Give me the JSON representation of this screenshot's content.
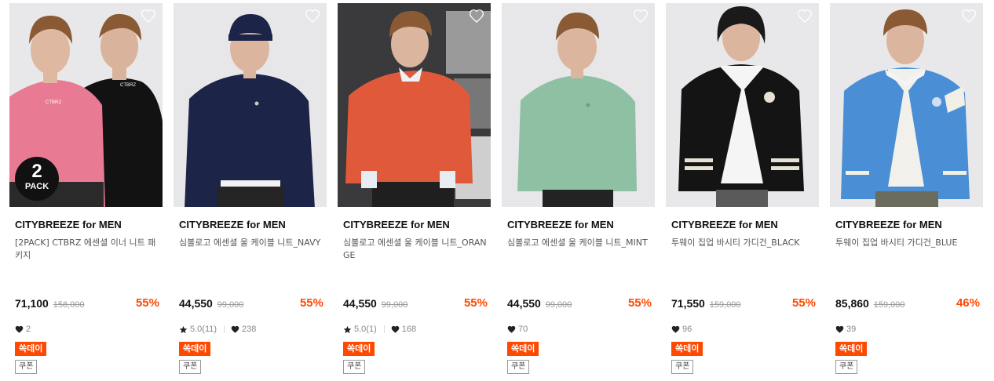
{
  "products": [
    {
      "brand": "CITYBREEZE for MEN",
      "name": "[2PACK] CTBRZ 에센셜 이너 니트 패키지",
      "price": "71,100",
      "original_price": "158,000",
      "discount": "55%",
      "rating": "",
      "rating_count": "",
      "likes": "2",
      "sale_tag": "쏙데이",
      "coupon_tag": "쿠폰",
      "pack_badge_number": "2",
      "pack_badge_text": "PACK",
      "image_bg": "#e8e8ea",
      "garment_color": "#e97a93",
      "garment_color_2": "#121212"
    },
    {
      "brand": "CITYBREEZE for MEN",
      "name": "심볼로고 에센셜 울 케이블 니트_NAVY",
      "price": "44,550",
      "original_price": "99,000",
      "discount": "55%",
      "rating": "5.0(11)",
      "rating_count": "",
      "likes": "238",
      "sale_tag": "쏙데이",
      "coupon_tag": "쿠폰",
      "image_bg": "#e7e7e9",
      "garment_color": "#1c2447"
    },
    {
      "brand": "CITYBREEZE for MEN",
      "name": "심볼로고 에센셜 울 케이블 니트_ORANGE",
      "price": "44,550",
      "original_price": "99,000",
      "discount": "55%",
      "rating": "5.0(1)",
      "rating_count": "",
      "likes": "168",
      "sale_tag": "쏙데이",
      "coupon_tag": "쿠폰",
      "image_bg": "#3a3a3c",
      "garment_color": "#e0593a"
    },
    {
      "brand": "CITYBREEZE for MEN",
      "name": "심볼로고 에센셜 울 케이블 니트_MINT",
      "price": "44,550",
      "original_price": "99,000",
      "discount": "55%",
      "rating": "",
      "rating_count": "",
      "likes": "70",
      "sale_tag": "쏙데이",
      "coupon_tag": "쿠폰",
      "image_bg": "#e7e7e9",
      "garment_color": "#8ec0a4"
    },
    {
      "brand": "CITYBREEZE for MEN",
      "name": "투웨이 집업 바시티 가디건_BLACK",
      "price": "71,550",
      "original_price": "159,000",
      "discount": "55%",
      "rating": "",
      "rating_count": "",
      "likes": "96",
      "sale_tag": "쏙데이",
      "coupon_tag": "쿠폰",
      "image_bg": "#e8e8ea",
      "garment_color": "#141414"
    },
    {
      "brand": "CITYBREEZE for MEN",
      "name": "투웨이 집업 바시티 가디건_BLUE",
      "price": "85,860",
      "original_price": "159,000",
      "discount": "46%",
      "rating": "",
      "rating_count": "",
      "likes": "39",
      "sale_tag": "쏙데이",
      "coupon_tag": "쿠폰",
      "image_bg": "#e8e8ea",
      "garment_color": "#4a8fd6"
    }
  ],
  "colors": {
    "discount": "#ff4800",
    "sale_tag_bg": "#ff4800",
    "price": "#111111",
    "original_price": "#999999"
  },
  "icons": {
    "wishlist": "heart-outline-icon",
    "likes": "heart-filled-icon",
    "rating": "star-icon"
  }
}
